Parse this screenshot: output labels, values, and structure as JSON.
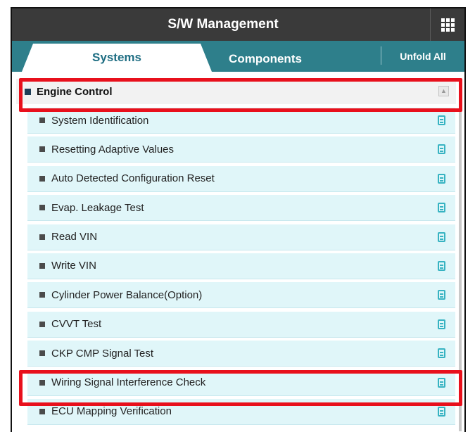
{
  "header": {
    "title": "S/W Management",
    "menu_icon": "grid-icon"
  },
  "tabs": [
    {
      "label": "Systems",
      "selected": true
    },
    {
      "label": "Components",
      "selected": false
    }
  ],
  "unfold_all": "Unfold All",
  "group": {
    "label": "Engine Control",
    "collapse_icon": "collapse-icon"
  },
  "items": [
    {
      "label": "System Identification"
    },
    {
      "label": "Resetting Adaptive Values"
    },
    {
      "label": "Auto Detected Configuration Reset"
    },
    {
      "label": "Evap. Leakage Test"
    },
    {
      "label": "Read VIN"
    },
    {
      "label": "Write VIN"
    },
    {
      "label": "Cylinder Power Balance(Option)"
    },
    {
      "label": "CVVT Test"
    },
    {
      "label": "CKP CMP Signal Test"
    },
    {
      "label": "Wiring Signal Interference Check"
    },
    {
      "label": "ECU Mapping Verification"
    }
  ],
  "colors": {
    "header": "#3a3a3a",
    "tabbar": "#2e7f8b",
    "row_bg": "#e0f6f9",
    "highlight": "#e8101c",
    "doc_icon": "#37b3c2"
  }
}
